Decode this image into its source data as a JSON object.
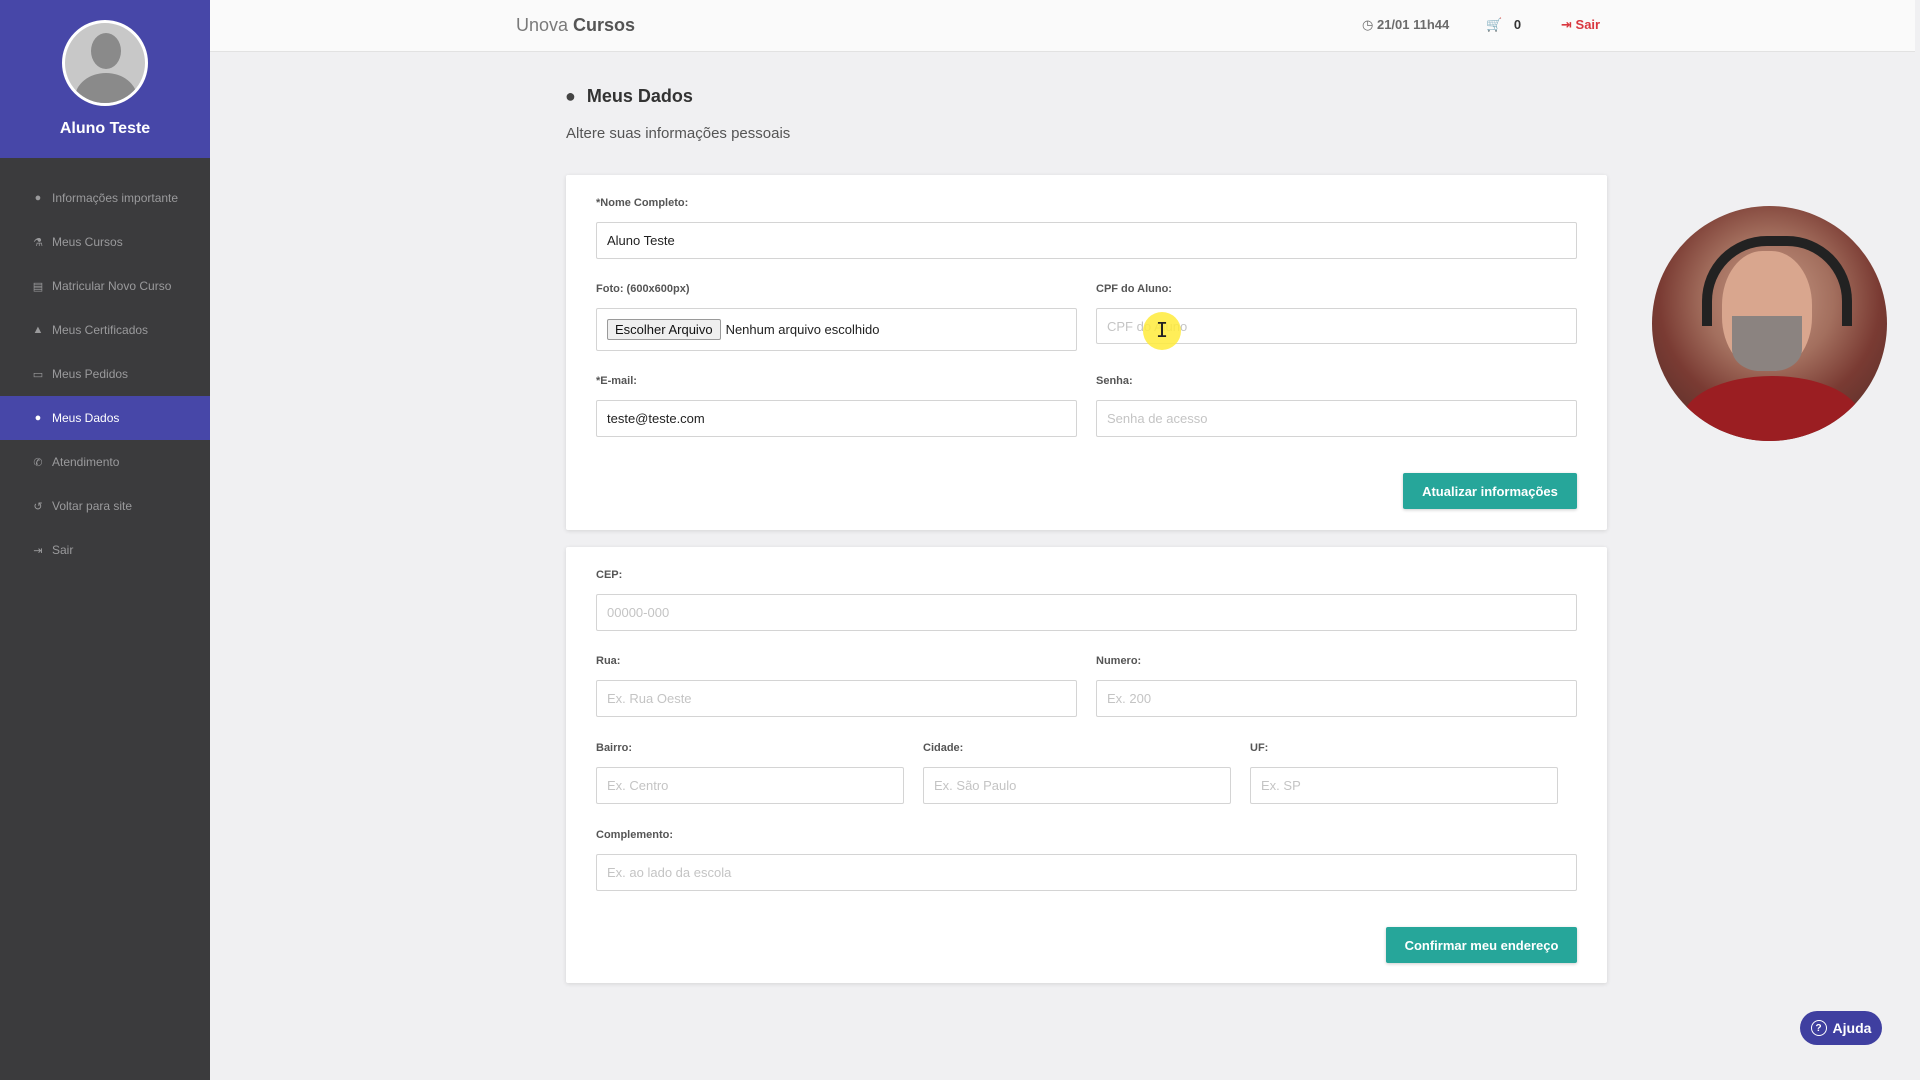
{
  "user": {
    "name": "Aluno Teste"
  },
  "sidebar": {
    "items": [
      {
        "label": "Informações importante",
        "icon": "info-icon"
      },
      {
        "label": "Meus Cursos",
        "icon": "flask-icon"
      },
      {
        "label": "Matricular Novo Curso",
        "icon": "book-icon"
      },
      {
        "label": "Meus Certificados",
        "icon": "graduation-cap-icon"
      },
      {
        "label": "Meus Pedidos",
        "icon": "credit-card-icon"
      },
      {
        "label": "Meus Dados",
        "icon": "user-icon",
        "active": true
      },
      {
        "label": "Atendimento",
        "icon": "phone-icon"
      },
      {
        "label": "Voltar para site",
        "icon": "undo-icon"
      },
      {
        "label": "Sair",
        "icon": "sign-in-icon"
      }
    ]
  },
  "header": {
    "brand_light": "Unova",
    "brand_bold": "Cursos",
    "time": "21/01 11h44",
    "cart_count": "0",
    "logout": "Sair"
  },
  "page": {
    "title": "Meus Dados",
    "subtitle": "Altere suas informações pessoais"
  },
  "personal_form": {
    "name_label": "*Nome Completo:",
    "name_value": "Aluno Teste",
    "photo_label": "Foto: (600x600px)",
    "file_button": "Escolher Arquivo",
    "file_status": "Nenhum arquivo escolhido",
    "cpf_label": "CPF do Aluno:",
    "cpf_placeholder": "CPF do Aluno",
    "email_label": "*E-mail:",
    "email_value": "teste@teste.com",
    "password_label": "Senha:",
    "password_placeholder": "Senha de acesso",
    "submit": "Atualizar informações"
  },
  "address_form": {
    "cep_label": "CEP:",
    "cep_placeholder": "00000-000",
    "street_label": "Rua:",
    "street_placeholder": "Ex. Rua Oeste",
    "number_label": "Numero:",
    "number_placeholder": "Ex. 200",
    "district_label": "Bairro:",
    "district_placeholder": "Ex. Centro",
    "city_label": "Cidade:",
    "city_placeholder": "Ex. São Paulo",
    "state_label": "UF:",
    "state_placeholder": "Ex. SP",
    "complement_label": "Complemento:",
    "complement_placeholder": "Ex. ao lado da escola",
    "submit": "Confirmar meu endereço"
  },
  "help": {
    "label": "Ajuda"
  },
  "colors": {
    "sidebar_bg": "#3b3b3d",
    "accent_purple": "#4747a8",
    "button_teal": "#26a69a",
    "logout_red": "#d9363e"
  }
}
